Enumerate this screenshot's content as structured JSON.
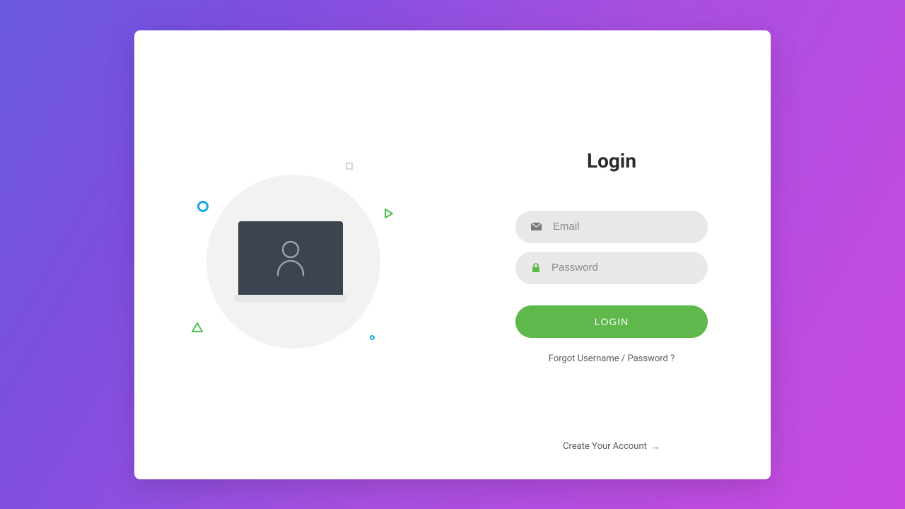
{
  "form": {
    "title": "Login",
    "email": {
      "value": "",
      "placeholder": "Email"
    },
    "password": {
      "value": "",
      "placeholder": "Password"
    },
    "submit_label": "LOGIN",
    "forgot_label": "Forgot Username / Password ?",
    "create_label": "Create Your Account",
    "create_arrow": "→"
  },
  "icons": {
    "email": "envelope-icon",
    "password": "lock-icon",
    "illustration": "user-on-laptop"
  },
  "colors": {
    "accent_green": "#5fb84b",
    "input_bg": "#e8e8e8",
    "bg_gradient_start": "#6a5ae0",
    "bg_gradient_end": "#c94ae0",
    "deco_blue": "#1aa8e6",
    "deco_green": "#4bbf4b"
  }
}
